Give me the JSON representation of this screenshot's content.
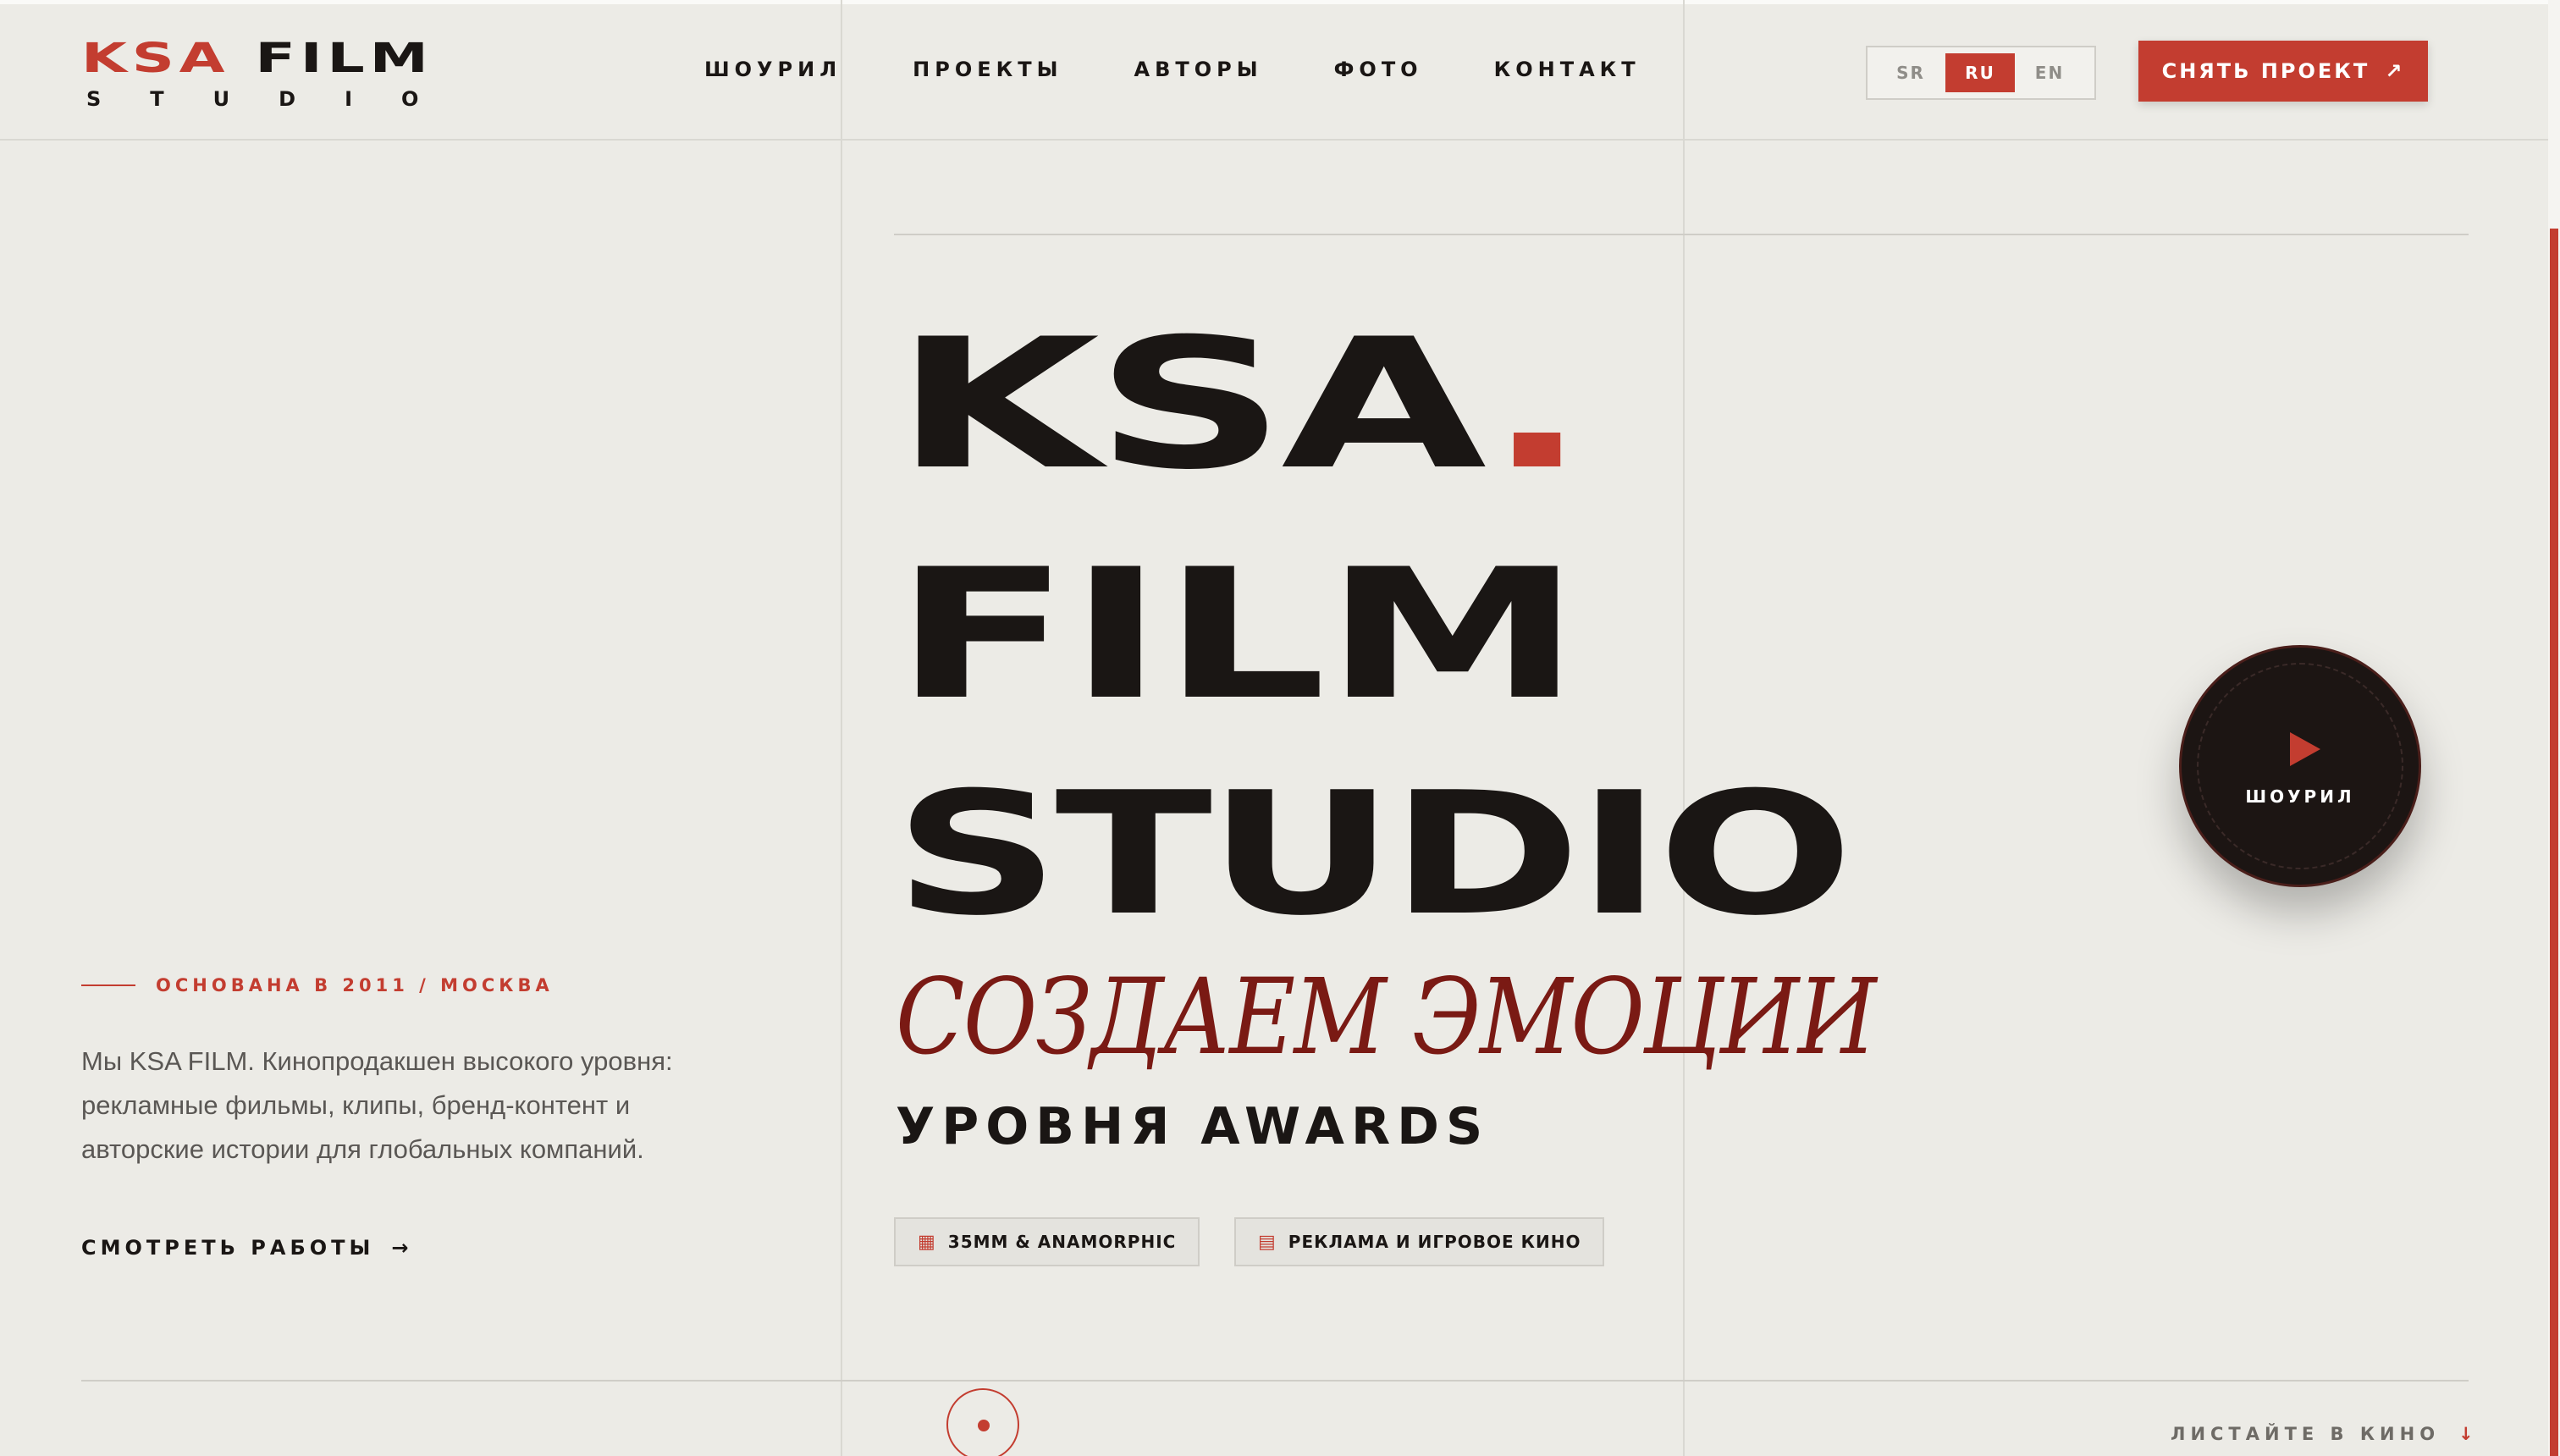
{
  "logo": {
    "word1": "KSA",
    "word2": "FILM",
    "word3": "STUDIO"
  },
  "nav": {
    "items": [
      "ШОУРИЛ",
      "ПРОЕКТЫ",
      "АВТОРЫ",
      "ФОТО",
      "КОНТАКТ"
    ]
  },
  "lang": {
    "options": [
      "SR",
      "RU",
      "EN"
    ],
    "active": "RU"
  },
  "cta": {
    "label": "СНЯТЬ ПРОЕКТ",
    "icon": "↗"
  },
  "hero": {
    "line1": "KSA",
    "line1_dot": ".",
    "line2": "FILM",
    "line3": "STUDIO",
    "tagline": "СОЗДАЕМ ЭМОЦИИ",
    "subtitle": "УРОВНЯ AWARDS",
    "badges": [
      {
        "icon": "film-icon",
        "label": "35MM & ANAMORPHIC"
      },
      {
        "icon": "clapper-icon",
        "label": "РЕКЛАМА И ИГРОВОЕ КИНО"
      }
    ]
  },
  "intro": {
    "founded": "ОСНОВАНА В 2011 / МОСКВА",
    "description": "Мы KSA FILM. Кинопродакшен высокого уровня: рекламные фильмы, клипы, бренд-контент и авторские истории для глобальных компаний.",
    "works_label": "СМОТРЕТЬ РАБОТЫ",
    "works_arrow": "→"
  },
  "showreel": {
    "label": "ШОУРИЛ"
  },
  "scroll": {
    "label": "ЛИСТАЙТЕ В КИНО",
    "arrow": "↓"
  },
  "colors": {
    "accent": "#c33d30",
    "background": "#ecebe6",
    "text": "#1a1614",
    "tagline": "#7a1a14"
  }
}
